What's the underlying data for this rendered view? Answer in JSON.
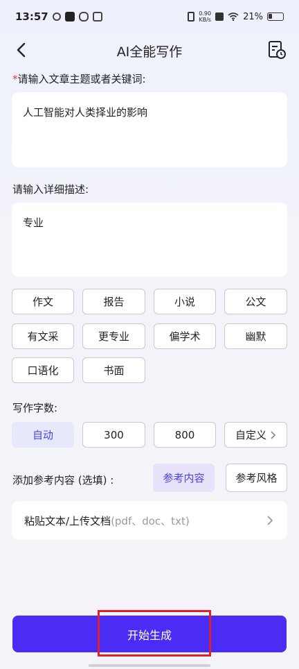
{
  "status": {
    "time": "13:57",
    "net_speed_value": "0.90",
    "net_speed_unit": "KB/s",
    "battery": "21%"
  },
  "nav": {
    "title": "AI全能写作"
  },
  "topic": {
    "required_mark": "*",
    "label": "请输入文章主题或者关键词:",
    "value": "人工智能对人类择业的影响"
  },
  "description": {
    "label": "请输入详细描述:",
    "value": "专业"
  },
  "styles": [
    "作文",
    "报告",
    "小说",
    "公文",
    "有文采",
    "更专业",
    "偏学术",
    "幽默",
    "口语化",
    "书面"
  ],
  "word_count": {
    "label": "写作字数:",
    "options": [
      "自动",
      "300",
      "800",
      "自定义"
    ],
    "selected": "自动"
  },
  "reference": {
    "label": "添加参考内容 (选填) :",
    "tabs": [
      "参考内容",
      "参考风格"
    ],
    "selected": "参考内容",
    "upload_label": "粘贴文本/上传文档",
    "upload_hint": "(pdf、doc、txt)"
  },
  "start_button": "开始生成",
  "colors": {
    "accent": "#4a2cf5",
    "highlight": "#e0202a",
    "required": "#e53935"
  }
}
